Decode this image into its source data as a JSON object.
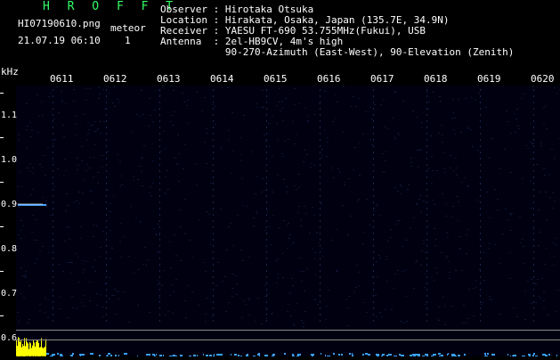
{
  "header": {
    "title": "H R O F F T",
    "file": "HI07190610.png",
    "meteor_label": "meteor",
    "datetime": "21.07.19 06:10",
    "meteor_count": "1",
    "observer": "Observer : Hirotaka Otsuka",
    "location": "Location : Hirakata, Osaka, Japan (135.7E, 34.9N)",
    "receiver": "Receiver : YAESU FT-690 53.755MHz(Fukui), USB",
    "antenna": "Antenna  : 2el-HB9CV, 4m's high",
    "antenna2": "           90-270-Azimuth (East-West), 90-Elevation (Zenith)"
  },
  "axis": {
    "unit": "kHz",
    "time_ticks": [
      "0611",
      "0612",
      "0613",
      "0614",
      "0615",
      "0616",
      "0617",
      "0618",
      "0619",
      "0620"
    ],
    "freq_ticks": [
      "1.1",
      "1.0",
      "0.9",
      "0.8",
      "0.7",
      "0.6"
    ]
  },
  "colors": {
    "trace": "#4aa3ff",
    "noise_bar": "#ffff00",
    "title": "#33ff66"
  }
}
